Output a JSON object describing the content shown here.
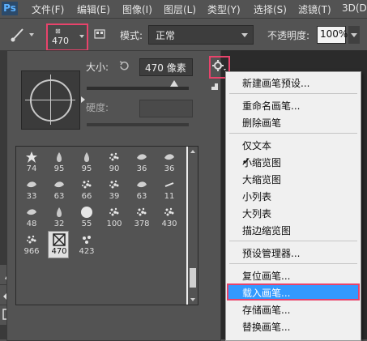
{
  "menubar": {
    "logo": "Ps",
    "items": [
      "文件(F)",
      "编辑(E)",
      "图像(I)",
      "图层(L)",
      "类型(Y)",
      "选择(S)",
      "滤镜(T)",
      "3D(D)"
    ]
  },
  "options": {
    "brush_size": "470",
    "mode_label": "模式:",
    "mode_value": "正常",
    "opacity_label": "不透明度:",
    "opacity_value": "100%"
  },
  "brush_panel": {
    "size_label": "大小:",
    "size_value": "470 像素",
    "size_slider_fraction": 0.86,
    "hardness_label": "硬度:",
    "presets": [
      {
        "num": "74"
      },
      {
        "num": "95"
      },
      {
        "num": "95"
      },
      {
        "num": "90"
      },
      {
        "num": "36"
      },
      {
        "num": "36"
      },
      {
        "num": "33"
      },
      {
        "num": "63"
      },
      {
        "num": "66"
      },
      {
        "num": "39"
      },
      {
        "num": "63"
      },
      {
        "num": "11"
      },
      {
        "num": "48"
      },
      {
        "num": "32"
      },
      {
        "num": "55"
      },
      {
        "num": "100"
      },
      {
        "num": "378"
      },
      {
        "num": "430"
      },
      {
        "num": "966"
      },
      {
        "num": "470",
        "selected": true
      },
      {
        "num": "423"
      }
    ]
  },
  "context_menu": {
    "items": [
      {
        "label": "新建画笔预设..."
      },
      {
        "label": "重命名画笔..."
      },
      {
        "label": "删除画笔"
      },
      {
        "label": "仅文本"
      },
      {
        "label": "小缩览图",
        "checked": true
      },
      {
        "label": "大缩览图"
      },
      {
        "label": "小列表"
      },
      {
        "label": "大列表"
      },
      {
        "label": "描边缩览图"
      },
      {
        "label": "预设管理器..."
      },
      {
        "label": "复位画笔..."
      },
      {
        "label": "载入画笔...",
        "highlighted": true
      },
      {
        "label": "存储画笔..."
      },
      {
        "label": "替换画笔..."
      }
    ]
  },
  "colors": {
    "highlight": "#3399ff",
    "annotation": "#e8436b"
  }
}
